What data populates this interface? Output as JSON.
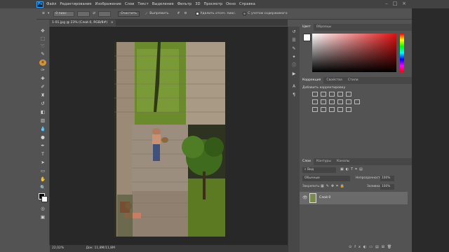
{
  "menu": [
    "Файл",
    "Редактирование",
    "Изображение",
    "Слои",
    "Текст",
    "Выделение",
    "Фильтр",
    "3D",
    "Просмотр",
    "Окно",
    "Справка"
  ],
  "options": {
    "feather": "0 пикс",
    "clear": "Очистить",
    "straighten": "Выпрямить",
    "delete_cropped": "Удалить отсеч. пикс.",
    "content_aware": "С учетом содержимого"
  },
  "document": {
    "tab": "1-01.jpg @ 23% (Слой 0, RGB/8#)",
    "close": "×"
  },
  "status": {
    "zoom": "22,02%",
    "doc": "Док: 11,8М/11,8М"
  },
  "color_panel": {
    "tabs": [
      "Цвет",
      "Образцы"
    ]
  },
  "adjust_panel": {
    "tabs": [
      "Коррекция",
      "Свойства",
      "Стили"
    ],
    "title": "Добавить корректировку"
  },
  "layers_panel": {
    "tabs": [
      "Слои",
      "Контуры",
      "Каналы"
    ],
    "kind": "Вид",
    "blend": "Обычные",
    "opacity_label": "Непрозрачность:",
    "opacity": "100%",
    "lock_label": "Закрепить:",
    "fill_label": "Заливка:",
    "fill": "100%",
    "layer_name": "Слой 0"
  },
  "icons": [
    "crop-icon",
    "move-icon",
    "marquee-icon",
    "lasso-icon",
    "brush-icon",
    "eraser-icon",
    "zoom-icon",
    "hand-icon",
    "text-icon",
    "pen-icon"
  ],
  "colors": {
    "bg": "#535353",
    "canvas": "#282828",
    "accent": "#31a8ff",
    "highlight": "#e8a13a"
  }
}
